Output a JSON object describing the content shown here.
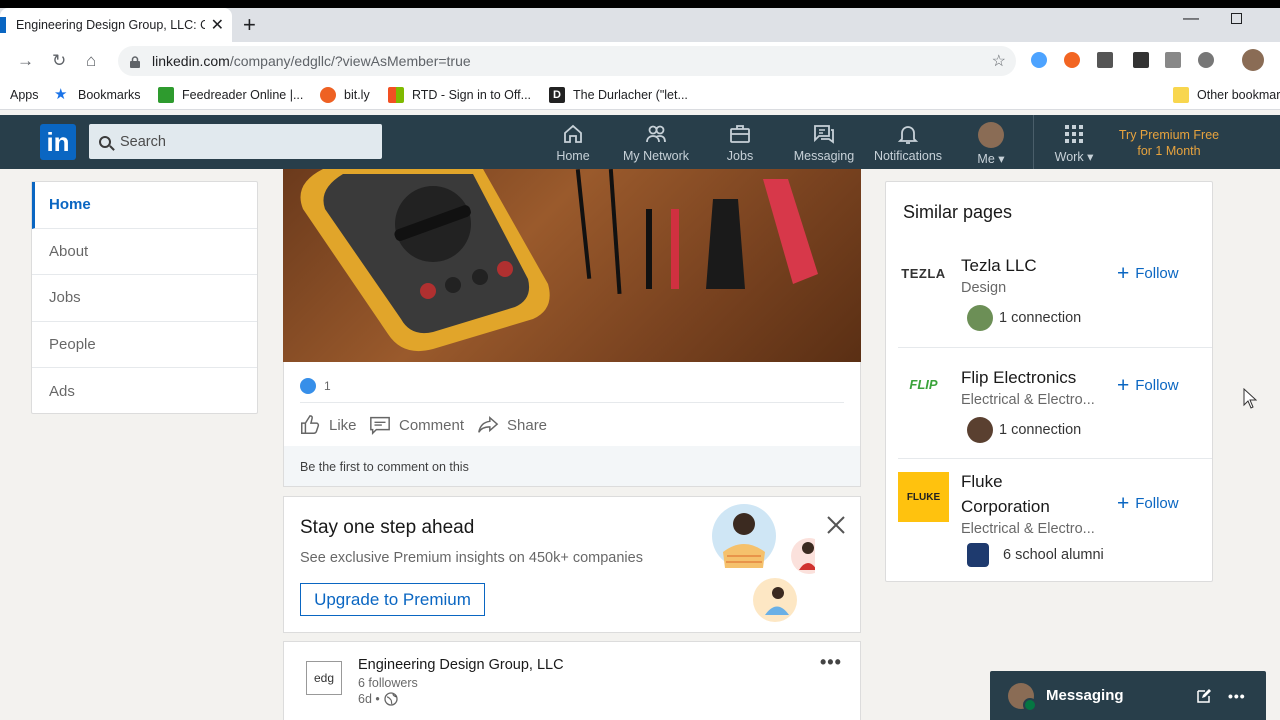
{
  "browser": {
    "tab_title": "Engineering Design Group, LLC: Overview | LinkedIn",
    "url_host": "linkedin.com",
    "url_path": "/company/edgllc/?viewAsMember=true",
    "bookmarks": [
      "Apps",
      "Bookmarks",
      "Feedreader Online |...",
      "bit.ly",
      "RTD - Sign in to Off...",
      "The Durlacher (\"let...",
      "Other bookmarks"
    ]
  },
  "nav": {
    "logo": "in",
    "search_placeholder": "Search",
    "items": [
      "Home",
      "My Network",
      "Jobs",
      "Messaging",
      "Notifications",
      "Me",
      "Work"
    ],
    "premium": "Try Premium Free for 1 Month"
  },
  "left_nav": [
    "Home",
    "About",
    "Jobs",
    "People",
    "Ads"
  ],
  "post": {
    "reaction_count": "1",
    "actions": [
      "Like",
      "Comment",
      "Share"
    ],
    "first_comment": "Be the first to comment on this"
  },
  "promo": {
    "title": "Stay one step ahead",
    "subtitle": "See exclusive Premium insights on 450k+ companies",
    "button": "Upgrade to Premium"
  },
  "company": {
    "logo_text": "edg",
    "name": "Engineering Design Group, LLC",
    "followers": "6 followers",
    "time": "6d •"
  },
  "similar": {
    "title": "Similar pages",
    "follow_label": "Follow",
    "pages": [
      {
        "logo": "TEZLA",
        "name": "Tezla LLC",
        "category": "Design",
        "conn": "1 connection"
      },
      {
        "logo": "FLIP",
        "name": "Flip Electronics",
        "category": "Electrical & Electro...",
        "conn": "1 connection"
      },
      {
        "logo": "FLUKE",
        "name": "Fluke Corporation",
        "category": "Electrical & Electro...",
        "conn": "6 school alumni"
      }
    ]
  },
  "messaging": {
    "label": "Messaging"
  },
  "colors": {
    "linkedin_blue": "#0a66c2",
    "nav_bg": "#283e4a",
    "premium_gold": "#e7a33e"
  }
}
